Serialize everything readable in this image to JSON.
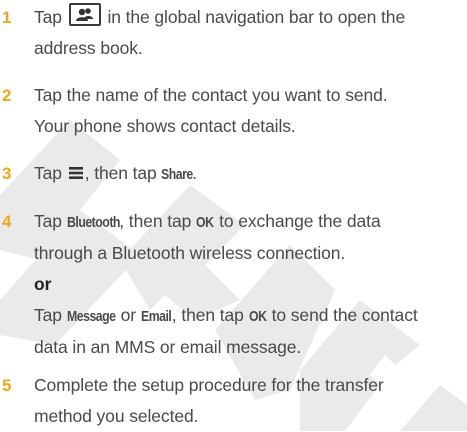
{
  "steps": [
    {
      "number": "1",
      "line1_a": "Tap",
      "line1_b": "in the global navigation bar to open the",
      "line2": "address book."
    },
    {
      "number": "2",
      "line1": "Tap the name of the contact you want to send.",
      "line2": "Your phone shows contact details."
    },
    {
      "number": "3",
      "text_a": "Tap",
      "text_b": ", then tap",
      "share": "Share",
      "text_c": "."
    },
    {
      "number": "4",
      "tap1": "Tap",
      "bluetooth": "Bluetooth",
      "then_tap1": ", then tap",
      "ok1": "OK",
      "line1_end": "to exchange the data",
      "line2": "through a Bluetooth wireless connection.",
      "or": "or",
      "tap2": "Tap",
      "message": "Message",
      "or_word": "or",
      "email": "Email",
      "then_tap2": ", then tap",
      "ok2": "OK",
      "line4_end": "to send the contact",
      "line5": "data in an MMS or email message."
    },
    {
      "number": "5",
      "line1": "Complete the setup procedure for the transfer",
      "line2": "method you selected."
    }
  ],
  "icons": {
    "contacts_key": "contacts-key-icon",
    "menu_key": "menu-key-icon"
  },
  "colors": {
    "step_number": "#f2a51a",
    "body_text": "#4a4a4a",
    "watermark": "#e9e9e9"
  }
}
